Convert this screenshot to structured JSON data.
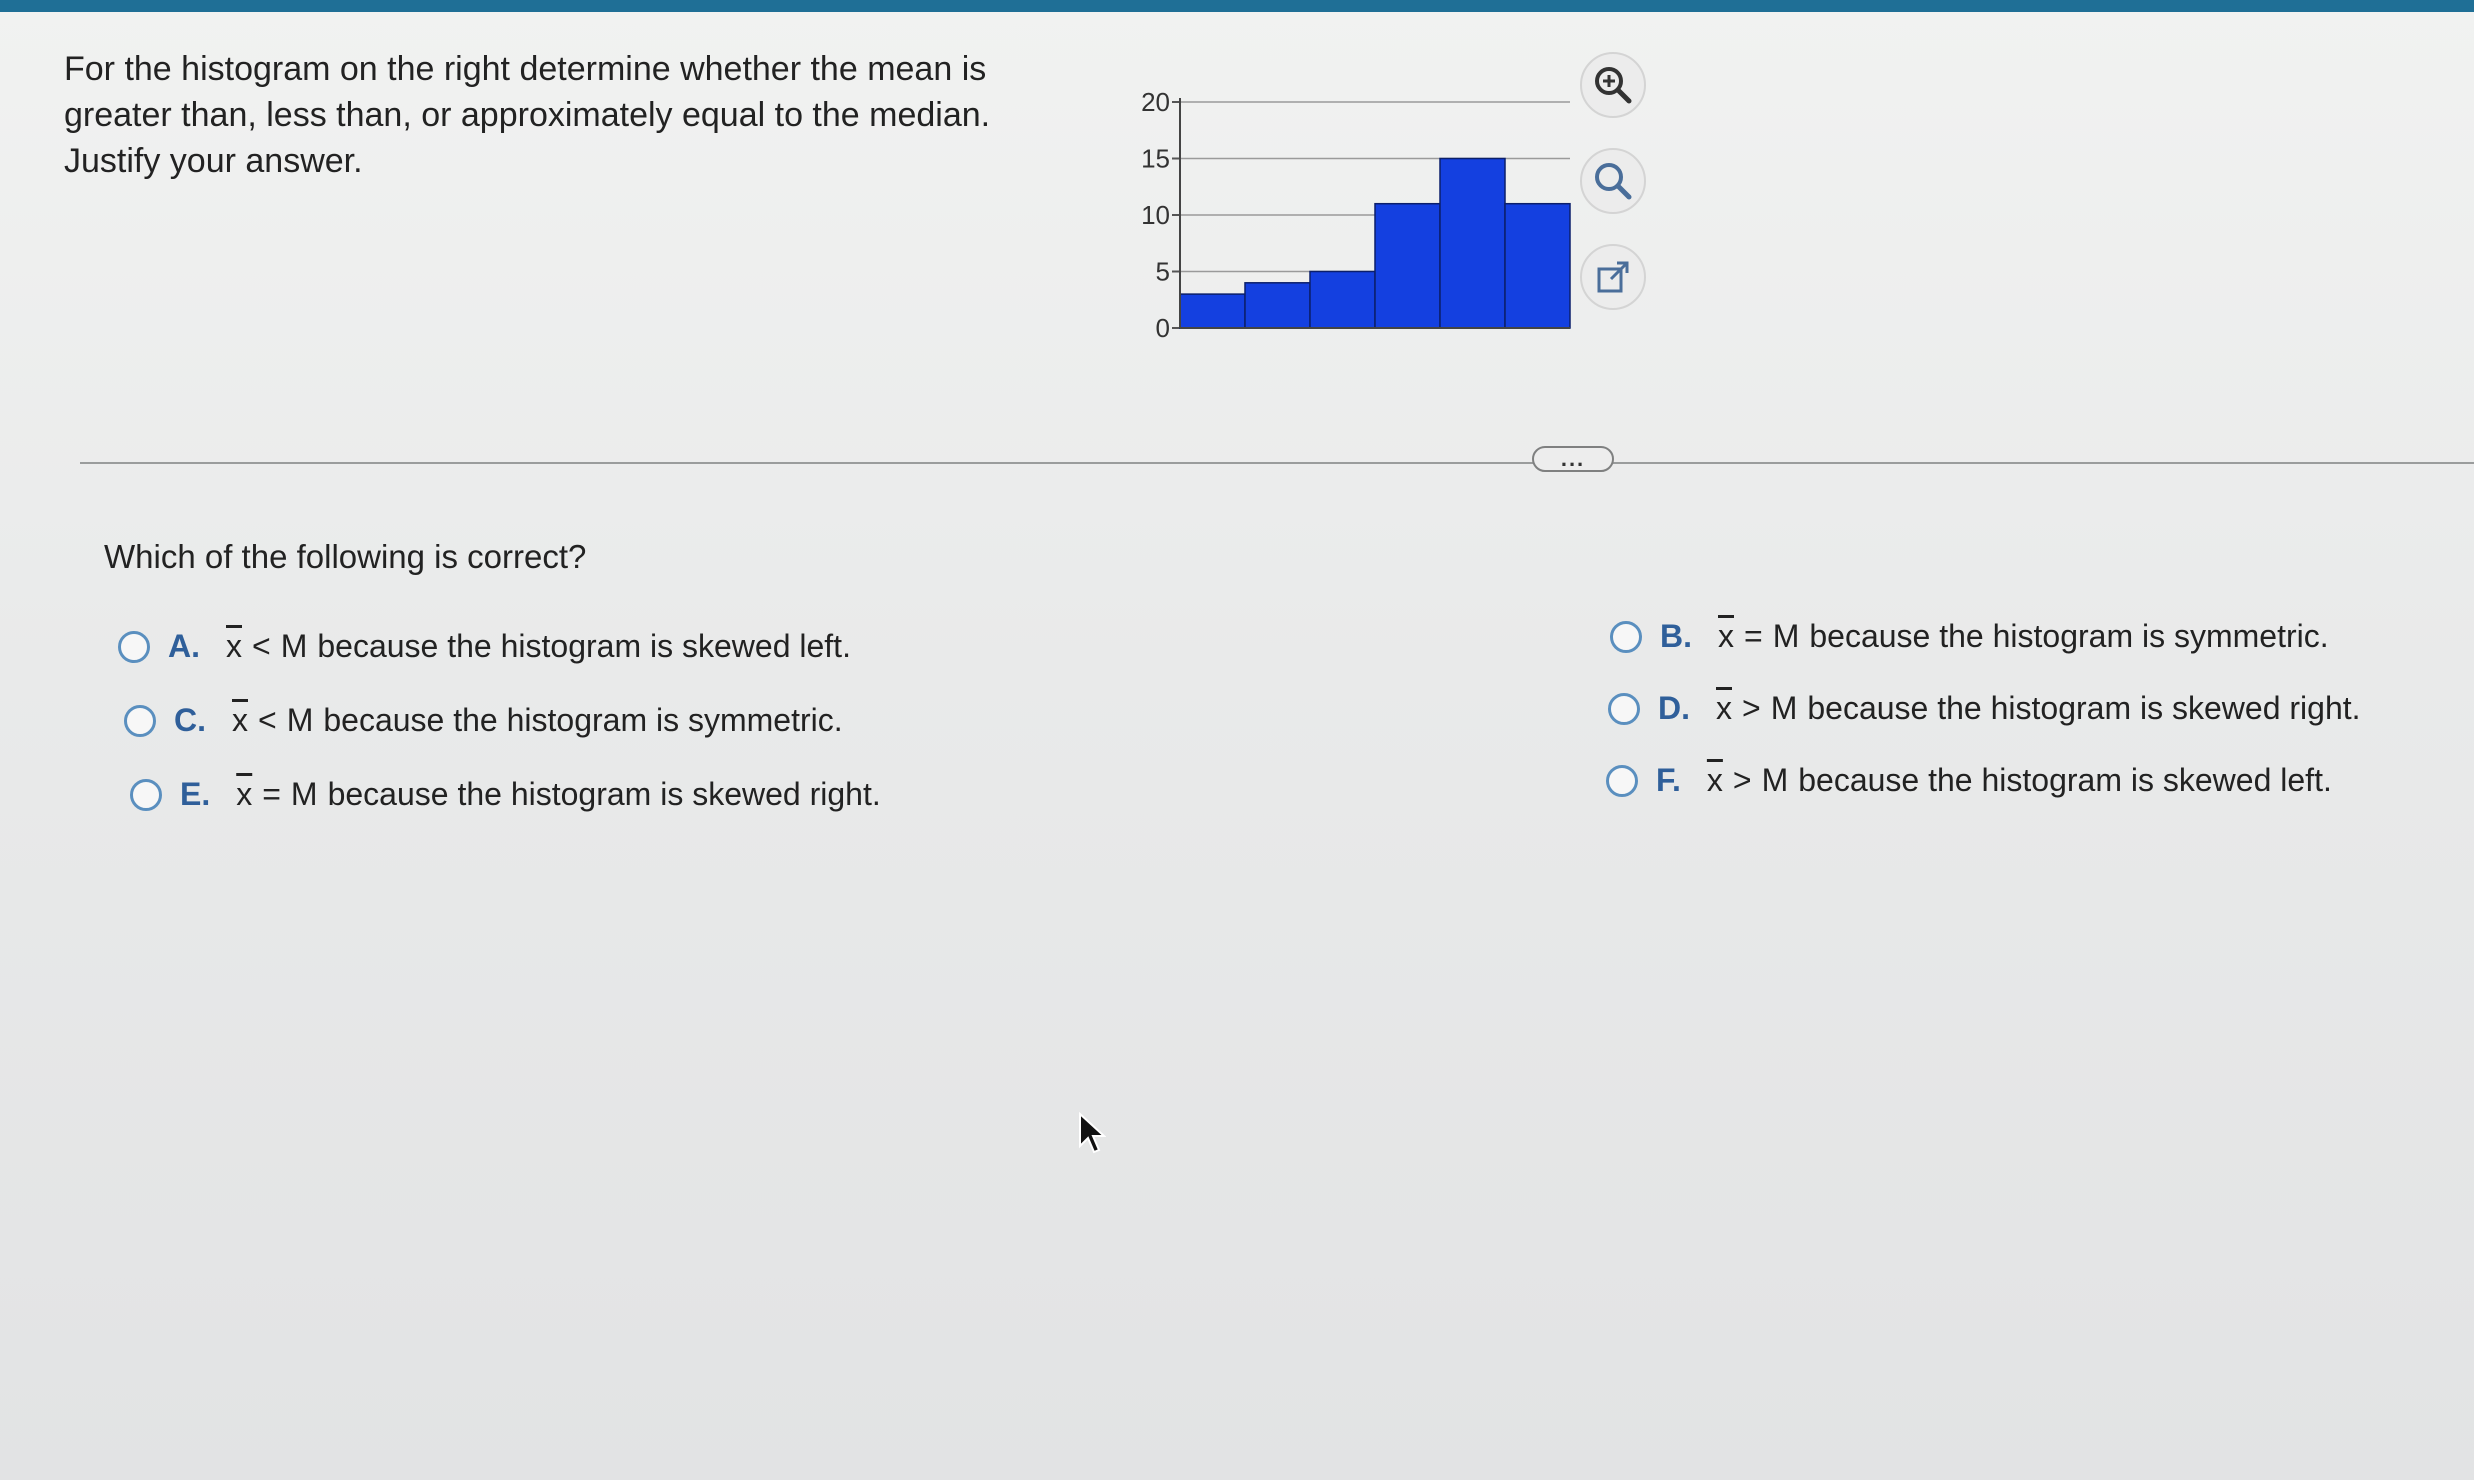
{
  "question": {
    "line1": "For the histogram on the right determine whether the mean is",
    "line2": "greater than, less than, or approximately equal to the median.",
    "line3": "Justify your answer."
  },
  "chart_data": {
    "type": "bar",
    "values": [
      3,
      4,
      5,
      11,
      15,
      11
    ],
    "ylim": [
      0,
      20
    ],
    "yticks": [
      "0",
      "5",
      "10",
      "15",
      "20"
    ],
    "bar_color": "#1440e0",
    "grid": true
  },
  "tools": {
    "zoom_in": "zoom-in-icon",
    "zoom_out": "zoom-out-icon",
    "popout": "external-link-icon"
  },
  "divider": {
    "more_label": "..."
  },
  "prompt": "Which of the following is correct?",
  "options": [
    {
      "letter": "A.",
      "var": "x",
      "rel": "<",
      "rhs": "M",
      "text": "because the histogram is skewed left."
    },
    {
      "letter": "B.",
      "var": "x",
      "rel": "=",
      "rhs": "M",
      "text": "because the histogram is symmetric."
    },
    {
      "letter": "C.",
      "var": "x",
      "rel": "<",
      "rhs": "M",
      "text": "because the histogram is symmetric."
    },
    {
      "letter": "D.",
      "var": "x",
      "rel": ">",
      "rhs": "M",
      "text": "because the histogram is skewed right."
    },
    {
      "letter": "E.",
      "var": "x",
      "rel": "=",
      "rhs": "M",
      "text": "because the histogram is skewed right."
    },
    {
      "letter": "F.",
      "var": "x",
      "rel": ">",
      "rhs": "M",
      "text": "because the histogram is skewed left."
    }
  ],
  "colors": {
    "accent": "#1f6f96",
    "option_letter": "#2f5f9a",
    "radio_border": "#5a8fbf"
  }
}
